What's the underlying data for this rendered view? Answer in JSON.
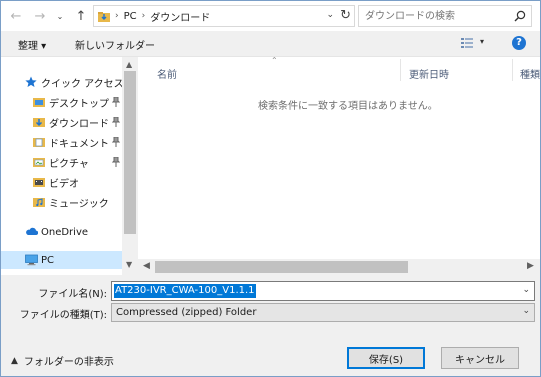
{
  "address_bar": {
    "crumbs": [
      "PC",
      "ダウンロード"
    ]
  },
  "search": {
    "placeholder": "ダウンロードの検索"
  },
  "toolbar": {
    "organize_label": "整理 ▾",
    "new_folder_label": "新しいフォルダー"
  },
  "sidebar": {
    "items": [
      {
        "label": "クイック アクセス",
        "icon": "star-icon"
      },
      {
        "label": "デスクトップ",
        "icon": "desktop-folder-icon",
        "pinned": true
      },
      {
        "label": "ダウンロード",
        "icon": "download-folder-icon",
        "pinned": true
      },
      {
        "label": "ドキュメント",
        "icon": "documents-folder-icon",
        "pinned": true
      },
      {
        "label": "ピクチャ",
        "icon": "pictures-folder-icon",
        "pinned": true
      },
      {
        "label": "ビデオ",
        "icon": "videos-folder-icon"
      },
      {
        "label": "ミュージック",
        "icon": "music-folder-icon"
      },
      {
        "label": "OneDrive",
        "icon": "cloud-icon"
      },
      {
        "label": "PC",
        "icon": "pc-icon",
        "selected": true
      }
    ]
  },
  "file_list": {
    "columns": [
      "名前",
      "更新日時",
      "種類"
    ],
    "empty_message": "検索条件に一致する項目はありません。"
  },
  "form": {
    "filename_label": "ファイル名(N):",
    "filename_value": "AT230-IVR_CWA-100_V1.1.1",
    "filetype_label": "ファイルの種類(T):",
    "filetype_value": "Compressed (zipped) Folder"
  },
  "footer": {
    "hide_folders_label": "フォルダーの非表示",
    "save_label": "保存(S)",
    "cancel_label": "キャンセル"
  },
  "colors": {
    "accent": "#0078d7",
    "selection": "#cce8ff",
    "help": "#1e74d2"
  }
}
